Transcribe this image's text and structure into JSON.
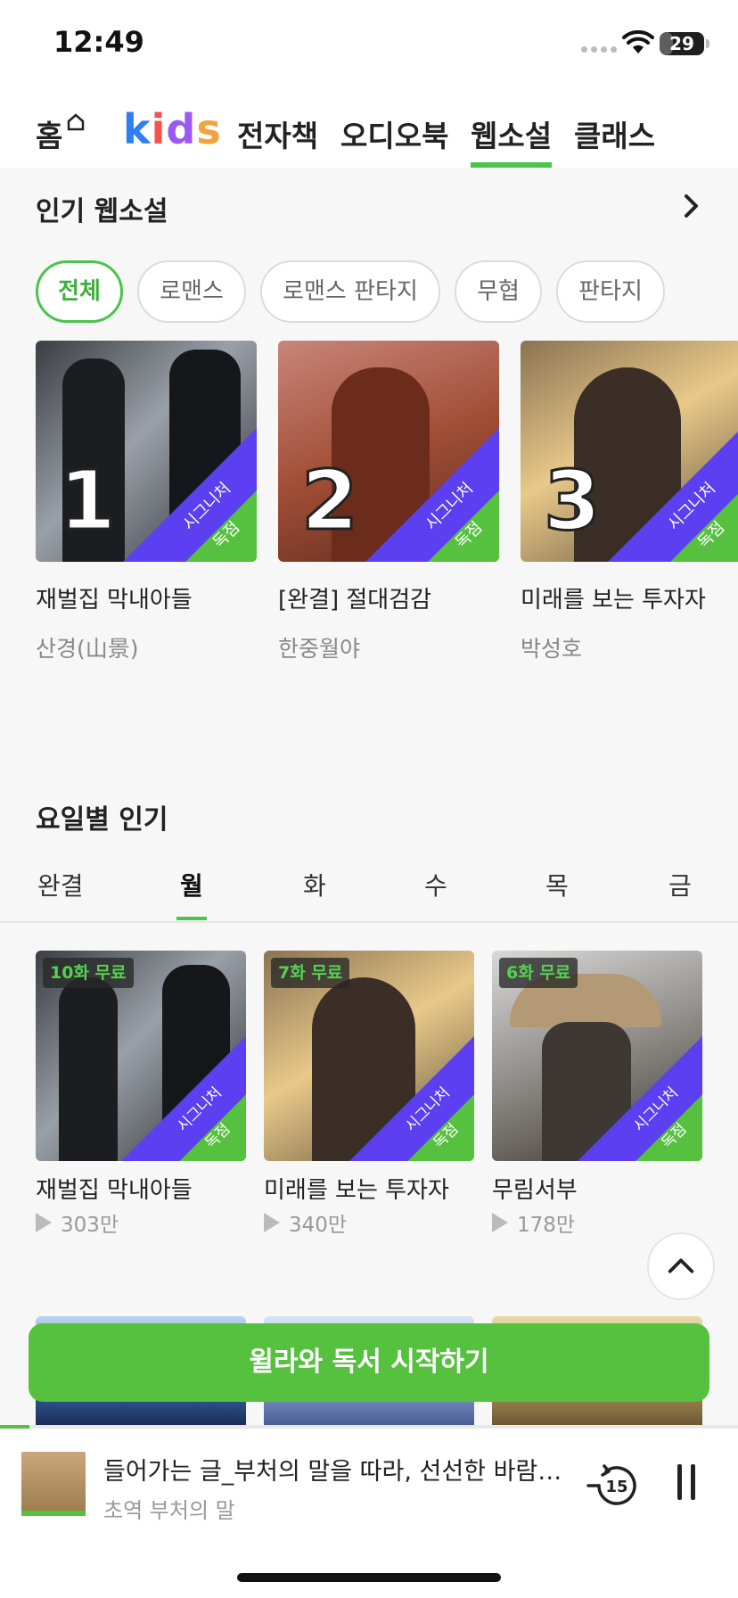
{
  "status": {
    "time": "12:49",
    "battery": "29"
  },
  "topnav": {
    "tabs": [
      {
        "label": "홈"
      },
      {
        "label": "kids"
      },
      {
        "label": "전자책"
      },
      {
        "label": "오디오북"
      },
      {
        "label": "웹소설",
        "active": true
      },
      {
        "label": "클래스"
      }
    ],
    "kids_colors": [
      "#2f7ff2",
      "#f2534b",
      "#9c59f2",
      "#f2a33a"
    ]
  },
  "popular": {
    "title": "인기 웹소설",
    "chips": [
      "전체",
      "로맨스",
      "로맨스 판타지",
      "무협",
      "판타지"
    ],
    "items": [
      {
        "rank": "1",
        "title": "재벌집 막내아들",
        "author": "산경(山景)",
        "ribbon_top": "시그니처",
        "ribbon_bottom": "독점"
      },
      {
        "rank": "2",
        "title": "[완결] 절대검감",
        "author": "한중월야",
        "ribbon_top": "시그니처",
        "ribbon_bottom": "독점"
      },
      {
        "rank": "3",
        "title": "미래를 보는 투자자",
        "author": "박성호",
        "ribbon_top": "시그니처",
        "ribbon_bottom": "독점"
      }
    ]
  },
  "weekday": {
    "title": "요일별 인기",
    "days": [
      "완결",
      "월",
      "화",
      "수",
      "목",
      "금"
    ],
    "active_day": "월",
    "items": [
      {
        "badge": "10화 무료",
        "title": "재벌집 막내아들",
        "plays": "303만"
      },
      {
        "badge": "7화 무료",
        "title": "미래를 보는 투자자",
        "plays": "340만"
      },
      {
        "badge": "6화 무료",
        "title": "무림서부",
        "plays": "178만"
      }
    ]
  },
  "cta": {
    "label": "윌라와 독서 시작하기"
  },
  "player": {
    "title": "들어가는 글_부처의 말을 따라, 선선한 바람이…",
    "subtitle": "초역 부처의 말",
    "rewind": "15",
    "progress": 0.04
  },
  "colors": {
    "accent": "#55c13f",
    "ribbon_purple": "#5b3ff0",
    "ribbon_green": "#55c13f"
  }
}
